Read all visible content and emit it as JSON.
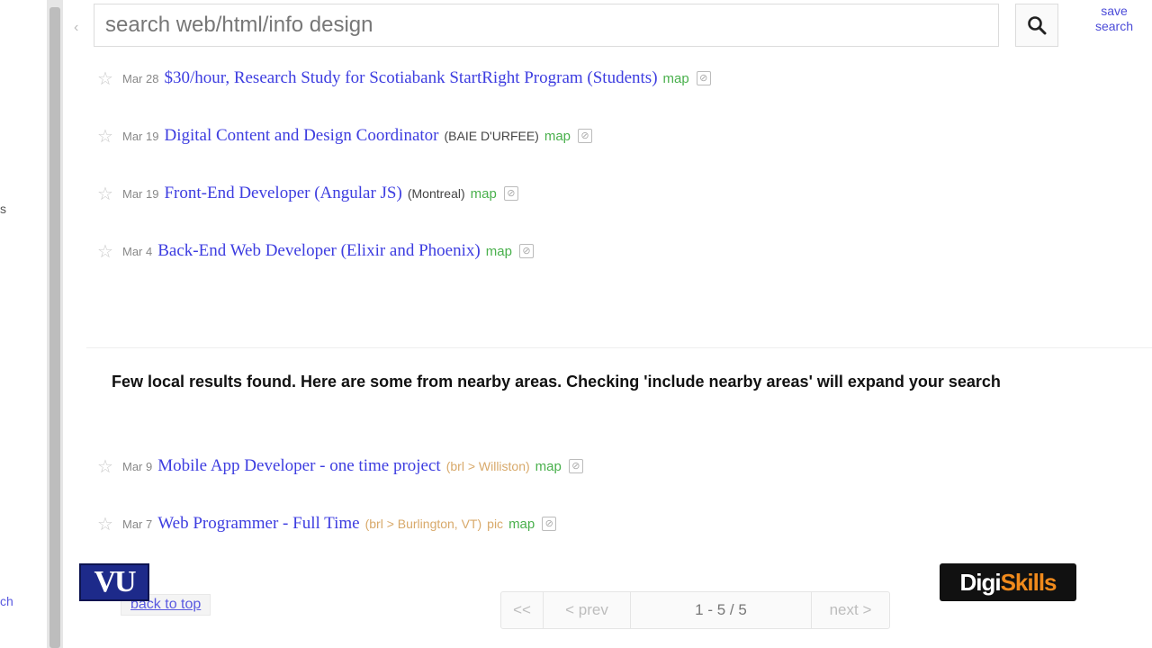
{
  "search": {
    "value": "search web/html/info design"
  },
  "save_search": {
    "line1": "save",
    "line2": "search"
  },
  "left_fragments": {
    "mid": "s",
    "bottom": "ch"
  },
  "listings": [
    {
      "date": "Mar 28",
      "title": "$30/hour, Research Study for Scotiabank StartRight Program (Students)",
      "hood": "",
      "map": "map"
    },
    {
      "date": "Mar 19",
      "title": "Digital Content and Design Coordinator",
      "hood": "(BAIE D'URFEE)",
      "map": "map"
    },
    {
      "date": "Mar 19",
      "title": "Front-End Developer (Angular JS)",
      "hood": "(Montreal)",
      "map": "map"
    },
    {
      "date": "Mar 4",
      "title": "Back-End Web Developer (Elixir and Phoenix)",
      "hood": "",
      "map": "map"
    }
  ],
  "notice": "Few local results found. Here are some from nearby areas. Checking 'include nearby areas' will expand your search",
  "nearby_listings": [
    {
      "date": "Mar 9",
      "title": "Mobile App Developer - one time project",
      "hood": "(brl > Williston)",
      "pic": "",
      "map": "map"
    },
    {
      "date": "Mar 7",
      "title": "Web Programmer - Full Time",
      "hood": "(brl > Burlington, VT)",
      "pic": "pic",
      "map": "map"
    }
  ],
  "back_to_top": "back to top",
  "pager": {
    "first": "<<",
    "prev": "< prev",
    "range": "1 - 5 / 5",
    "next": "next >"
  },
  "logos": {
    "vu": "VU",
    "digi_a": "Digi",
    "digi_b": "Skills"
  },
  "colors": {
    "link": "#3d3de0",
    "map": "#49b04c",
    "hood_nearby": "#d8a96a"
  }
}
